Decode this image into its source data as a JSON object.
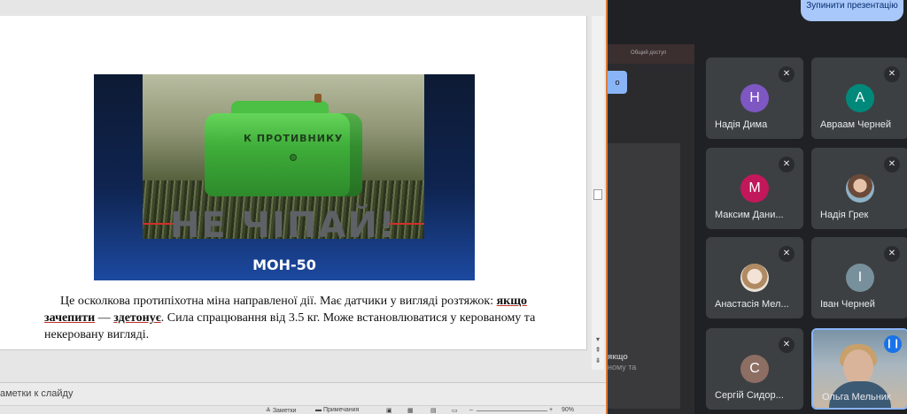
{
  "slide": {
    "banner": {
      "stamp_text": "К ПРОТИВНИКУ",
      "slogan": "НЕ ЧІПАЙ!",
      "code": "МОН-50"
    },
    "caption": {
      "t1": "Це осколкова протипіхотна міна направленої дії. Має датчики у вигляді розтяжок: ",
      "b1": "якщо зачепити",
      "t2": " — ",
      "b2": "здетонує",
      "t3": ". Сила спрацювання від 3.5 кг. Може встановлюватися у керованому та некеровану вигляді."
    }
  },
  "editor": {
    "notes_label": "аметки к слайду",
    "status": {
      "notes": "Заметки",
      "comments": "Примечания",
      "zoom": "90%"
    }
  },
  "meet": {
    "stop_presenting": "Зупинити презентацію",
    "ghost": {
      "bar_text": "Общий доступ",
      "pill": "о",
      "snip1": "якщо",
      "snip2": "ному та"
    },
    "participants": [
      {
        "name": "Надія Дима",
        "initial": "Н",
        "color": "#7e57c2",
        "muted": true
      },
      {
        "name": "Авраам Черней",
        "initial": "А",
        "color": "#00897b",
        "muted": true
      },
      {
        "name": "Максим Дани...",
        "initial": "М",
        "color": "#c2185b",
        "muted": true
      },
      {
        "name": "Надія Грек",
        "initial": "",
        "color": "#8d6e63",
        "muted": true
      },
      {
        "name": "Анастасія Мел...",
        "initial": "",
        "color": "#bcaaa4",
        "muted": true
      },
      {
        "name": "Іван Черней",
        "initial": "І",
        "color": "#78909c",
        "muted": true
      },
      {
        "name": "Сергій Сидор...",
        "initial": "С",
        "color": "#8d6e63",
        "muted": true
      },
      {
        "name": "Ольга Мельник",
        "initial": "",
        "color": "#3c4043",
        "muted": false
      }
    ],
    "icons": {
      "mic_off": "mic-off-icon",
      "speaking": "speaking-indicator-icon"
    }
  }
}
